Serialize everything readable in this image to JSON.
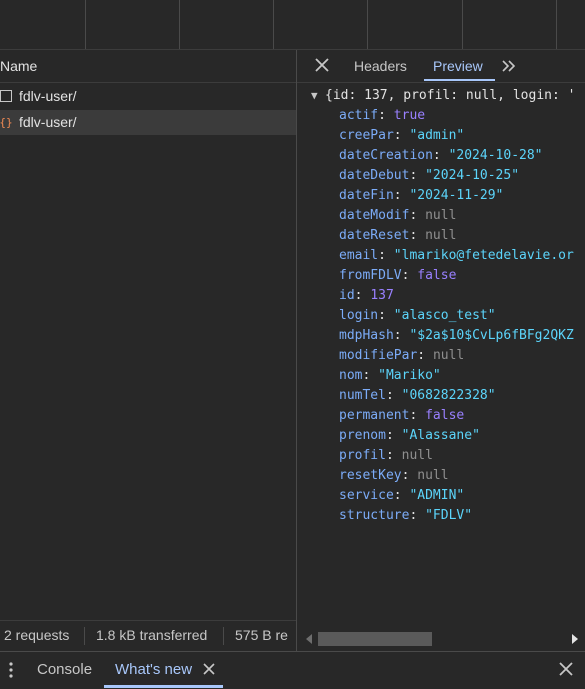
{
  "requests_panel": {
    "column_header": "Name",
    "items": [
      {
        "label": "fdlv-user/",
        "icon": "document-icon"
      },
      {
        "label": "fdlv-user/",
        "icon": "json-braces-icon"
      }
    ],
    "footer": {
      "requests": "2 requests",
      "transferred": "1.8 kB transferred",
      "resources": "575 B re"
    }
  },
  "preview_panel": {
    "tabs": [
      "Headers",
      "Preview"
    ],
    "active_tab": "Preview",
    "summary_line": "{id: 137, profil: null, login: '",
    "fields": [
      {
        "key": "actif",
        "value": "true",
        "type": "bool"
      },
      {
        "key": "creePar",
        "value": "\"admin\"",
        "type": "string"
      },
      {
        "key": "dateCreation",
        "value": "\"2024-10-28\"",
        "type": "string"
      },
      {
        "key": "dateDebut",
        "value": "\"2024-10-25\"",
        "type": "string"
      },
      {
        "key": "dateFin",
        "value": "\"2024-11-29\"",
        "type": "string"
      },
      {
        "key": "dateModif",
        "value": "null",
        "type": "null"
      },
      {
        "key": "dateReset",
        "value": "null",
        "type": "null"
      },
      {
        "key": "email",
        "value": "\"lmariko@fetedelavie.or",
        "type": "string"
      },
      {
        "key": "fromFDLV",
        "value": "false",
        "type": "bool"
      },
      {
        "key": "id",
        "value": "137",
        "type": "number"
      },
      {
        "key": "login",
        "value": "\"alasco_test\"",
        "type": "string"
      },
      {
        "key": "mdpHash",
        "value": "\"$2a$10$CvLp6fBFg2QKZ",
        "type": "string"
      },
      {
        "key": "modifiePar",
        "value": "null",
        "type": "null"
      },
      {
        "key": "nom",
        "value": "\"Mariko\"",
        "type": "string"
      },
      {
        "key": "numTel",
        "value": "\"0682822328\"",
        "type": "string"
      },
      {
        "key": "permanent",
        "value": "false",
        "type": "bool"
      },
      {
        "key": "prenom",
        "value": "\"Alassane\"",
        "type": "string"
      },
      {
        "key": "profil",
        "value": "null",
        "type": "null"
      },
      {
        "key": "resetKey",
        "value": "null",
        "type": "null"
      },
      {
        "key": "service",
        "value": "\"ADMIN\"",
        "type": "string"
      },
      {
        "key": "structure",
        "value": "\"FDLV\"",
        "type": "string"
      }
    ]
  },
  "drawer": {
    "tabs": [
      "Console",
      "What's new"
    ],
    "active_tab": "What's new"
  },
  "colors": {
    "accent": "#a8c7fa",
    "json_key": "#7cacf8",
    "json_string": "#5cd5fb",
    "json_number_bool": "#9980ff",
    "json_null": "#8f8f8f",
    "json_icon_orange": "#f28b54"
  }
}
